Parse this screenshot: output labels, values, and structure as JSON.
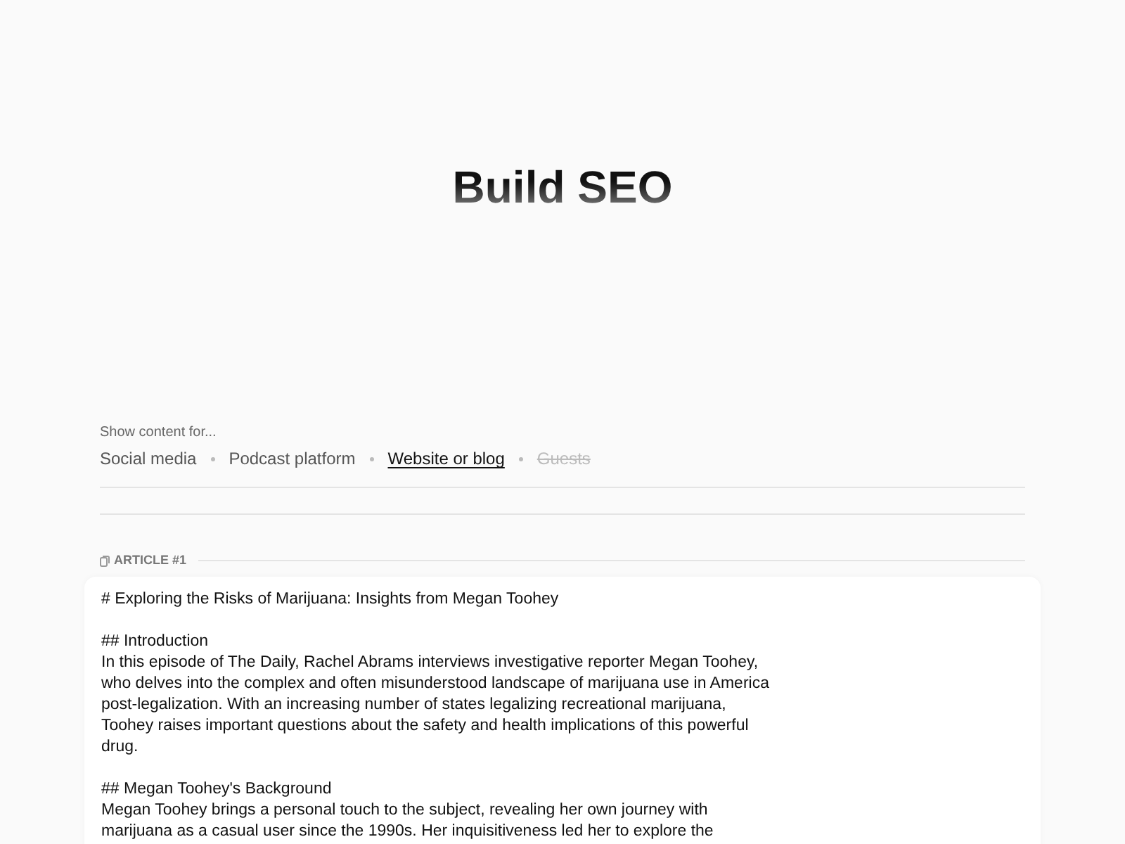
{
  "title": "Build SEO",
  "filter": {
    "label": "Show content for...",
    "options": [
      {
        "label": "Social media",
        "selected": false,
        "disabled": false
      },
      {
        "label": "Podcast platform",
        "selected": false,
        "disabled": false
      },
      {
        "label": "Website or blog",
        "selected": true,
        "disabled": false
      },
      {
        "label": "Guests",
        "selected": false,
        "disabled": true
      }
    ]
  },
  "article": {
    "label": "ARTICLE #1",
    "blocks": [
      {
        "kind": "heading",
        "text": "# Exploring the Risks of Marijuana: Insights from Megan Toohey"
      },
      {
        "kind": "heading",
        "text": "## Introduction"
      },
      {
        "kind": "paragraph",
        "text": "In this episode of The Daily, Rachel Abrams interviews investigative reporter Megan Toohey, who delves into the complex and often misunderstood landscape of marijuana use in America post-legalization. With an increasing number of states legalizing recreational marijuana, Toohey raises important questions about the safety and health implications of this powerful drug."
      },
      {
        "kind": "heading",
        "text": "## Megan Toohey's Background"
      },
      {
        "kind": "paragraph",
        "text": "Megan Toohey brings a personal touch to the subject, revealing her own journey with marijuana as a casual user since the 1990s. Her inquisitiveness led her to explore the"
      }
    ]
  }
}
